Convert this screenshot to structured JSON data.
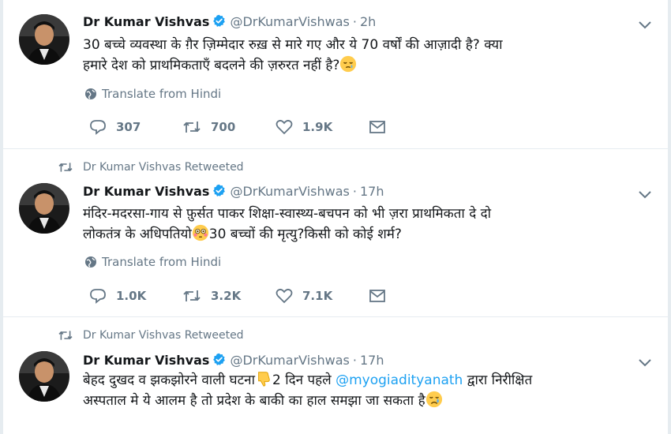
{
  "tweets": [
    {
      "retweet_label": "",
      "name": "Dr Kumar Vishvas",
      "handle": "@DrKumarVishwas",
      "separator": "·",
      "time": "2h",
      "text_line1": "30 बच्चे व्यवस्था के ग़ैर ज़िम्मेदार रुख़ से मारे गए और ये 70 वर्षों की आज़ादी है? क्या",
      "text_line2": "हमारे देश को प्राथमिकताएँ बदलने की ज़रुरत नहीं है?",
      "emoji": "sleepy-face-icon",
      "translate": "Translate from Hindi",
      "replies": "307",
      "retweets": "700",
      "likes": "1.9K"
    },
    {
      "retweet_label": "Dr Kumar Vishvas Retweeted",
      "name": "Dr Kumar Vishvas",
      "handle": "@DrKumarVishwas",
      "separator": "·",
      "time": "17h",
      "text_line1": "मंदिर-मदरसा-गाय से फ़ुर्सत पाकर शिक्षा-स्वास्थ्य-बचपन को भी ज़रा प्राथमिकता दे दो",
      "text_line2a": "लोकतंत्र के अधिपतियो",
      "text_line2b": "30 बच्चों की मृत्यु?किसी को कोई शर्म?",
      "emoji": "flushed-face-icon",
      "translate": "Translate from Hindi",
      "replies": "1.0K",
      "retweets": "3.2K",
      "likes": "7.1K"
    },
    {
      "retweet_label": "Dr Kumar Vishvas Retweeted",
      "name": "Dr Kumar Vishvas",
      "handle": "@DrKumarVishwas",
      "separator": "·",
      "time": "17h",
      "text_line1a": "बेहद दुखद व झकझोरने वाली घटना",
      "text_line1b": "2 दिन पहले ",
      "mention": "@myogiadityanath",
      "text_line1c": " द्वारा निरीक्षित",
      "text_line2": "अस्पताल मे ये आलम है तो प्रदेश के बाकी का हाल समझा जा सकता है",
      "emoji1": "thumbs-down-icon",
      "emoji2": "crying-face-icon"
    }
  ],
  "colors": {
    "text": "#14171a",
    "muted": "#657786",
    "link": "#1da1f2",
    "verified": "#1da1f2",
    "divider": "#e6ecf0"
  }
}
